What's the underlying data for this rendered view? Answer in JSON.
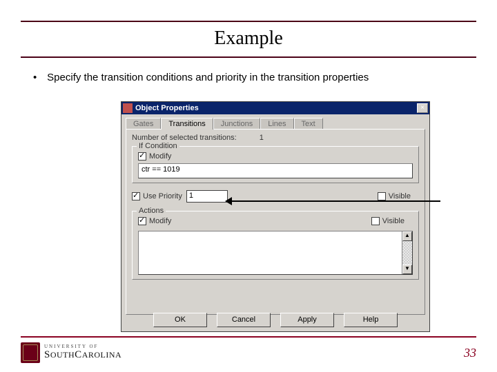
{
  "slide": {
    "title": "Example",
    "bullet": "Specify the transition conditions and priority in the transition properties",
    "page_number": "33"
  },
  "footer": {
    "university_line1": "UNIVERSITY OF",
    "university_line2": "SOUTH CAROLINA"
  },
  "dialog": {
    "title": "Object Properties",
    "tabs": {
      "gates": "Gates",
      "transitions": "Transitions",
      "junctions": "Junctions",
      "lines": "Lines",
      "text": "Text"
    },
    "selected_transitions_label": "Number of selected transitions:",
    "selected_transitions_value": "1",
    "group_condition": "If Condition",
    "modify_label": "Modify",
    "condition_value": "ctr == 1019",
    "use_priority_label": "Use Priority",
    "priority_value": "1",
    "visible_label": "Visible",
    "group_actions": "Actions",
    "buttons": {
      "ok": "OK",
      "cancel": "Cancel",
      "apply": "Apply",
      "help": "Help"
    }
  }
}
